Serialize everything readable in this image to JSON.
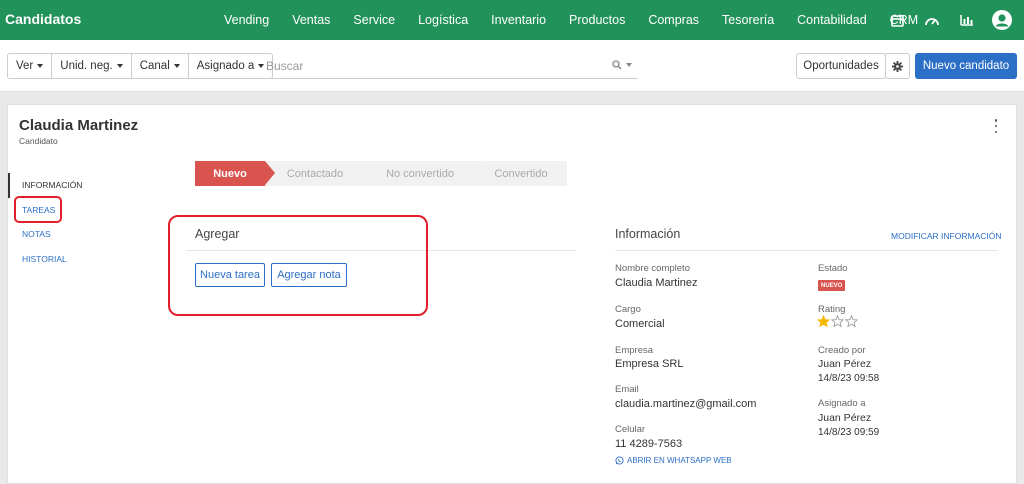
{
  "app": {
    "title": "Candidatos"
  },
  "nav": [
    "Vending",
    "Ventas",
    "Service",
    "Logística",
    "Inventario",
    "Productos",
    "Compras",
    "Tesorería",
    "Contabilidad",
    "CRM"
  ],
  "toolbar": {
    "filters": [
      "Ver",
      "Unid. neg.",
      "Canal",
      "Asignado a"
    ],
    "search_placeholder": "Buscar",
    "oportunidades": "Oportunidades",
    "nuevo": "Nuevo candidato"
  },
  "record": {
    "name": "Claudia Martinez",
    "type": "Candidato"
  },
  "sidenav": [
    "INFORMACIÓN",
    "TAREAS",
    "NOTAS",
    "HISTORIAL"
  ],
  "stages": [
    "Nuevo",
    "Contactado",
    "No convertido",
    "Convertido"
  ],
  "agregar": {
    "title": "Agregar",
    "nueva_tarea": "Nueva tarea",
    "agregar_nota": "Agregar nota"
  },
  "info": {
    "title": "Información",
    "modify": "MODIFICAR INFORMACIÓN",
    "nombre_label": "Nombre completo",
    "nombre": "Claudia Martinez",
    "cargo_label": "Cargo",
    "cargo": "Comercial",
    "empresa_label": "Empresa",
    "empresa": "Empresa SRL",
    "email_label": "Email",
    "email": "claudia.martinez@gmail.com",
    "celular_label": "Celular",
    "celular": "11 4289-7563",
    "whatsapp": "ABRIR EN WHATSAPP WEB",
    "estado_label": "Estado",
    "estado": "NUEVO",
    "rating_label": "Rating",
    "rating": 1,
    "rating_max": 3,
    "creado_label": "Creado por",
    "creado_por": "Juan Pérez",
    "creado_fecha": "14/8/23 09:58",
    "asignado_label": "Asignado a",
    "asignado": "Juan Pérez",
    "asignado_fecha": "14/8/23 09:59"
  },
  "colors": {
    "brand": "#21925a",
    "primary": "#2c6fc7",
    "stage_active": "#d9534f",
    "highlight": "#e2202c",
    "star": "#f5b800"
  }
}
